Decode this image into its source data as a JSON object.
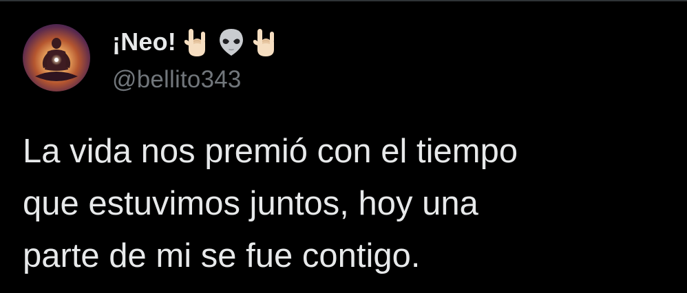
{
  "tweet": {
    "author": {
      "display_name": "¡Neo!",
      "handle": "@bellito343",
      "name_emojis": [
        "sign-of-horns-icon",
        "alien-icon",
        "sign-of-horns-icon"
      ],
      "avatar_icon": "meditating-figure-avatar"
    },
    "text": "La vida nos premió con el tiempo\nque estuvimos juntos, hoy una\nparte de mi se fue contigo."
  },
  "colors": {
    "background": "#000000",
    "primary_text": "#e7e9ea",
    "secondary_text": "#71767b",
    "divider": "#2f3336"
  }
}
